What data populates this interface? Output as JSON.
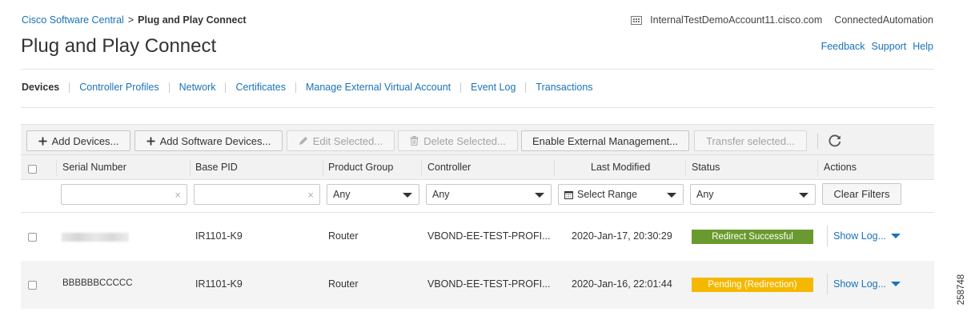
{
  "breadcrumb": {
    "root": "Cisco Software Central",
    "separator": ">",
    "current": "Plug and Play Connect"
  },
  "account": {
    "domain": "InternalTestDemoAccount11.cisco.com",
    "user": "ConnectedAutomation",
    "icon": "building-icon"
  },
  "page": {
    "title": "Plug and Play Connect"
  },
  "help_links": {
    "feedback": "Feedback",
    "support": "Support",
    "help": "Help"
  },
  "tabs": [
    {
      "label": "Devices",
      "active": true
    },
    {
      "label": "Controller Profiles"
    },
    {
      "label": "Network"
    },
    {
      "label": "Certificates"
    },
    {
      "label": "Manage External Virtual Account"
    },
    {
      "label": "Event Log"
    },
    {
      "label": "Transactions"
    }
  ],
  "toolbar": {
    "add_devices": "Add Devices...",
    "add_software_devices": "Add Software Devices...",
    "edit_selected": "Edit Selected...",
    "delete_selected": "Delete Selected...",
    "enable_external": "Enable External Management...",
    "transfer_selected": "Transfer selected..."
  },
  "columns": {
    "serial": "Serial Number",
    "base_pid": "Base PID",
    "product_group": "Product Group",
    "controller": "Controller",
    "last_modified": "Last Modified",
    "status": "Status",
    "actions": "Actions"
  },
  "filters": {
    "product_group": "Any",
    "controller": "Any",
    "last_modified": "Select Range",
    "status": "Any",
    "clear": "Clear Filters",
    "clear_glyph": "×"
  },
  "rows": [
    {
      "serial": "",
      "base_pid": "IR1101-K9",
      "product_group": "Router",
      "controller": "VBOND-EE-TEST-PROFI...",
      "last_modified": "2020-Jan-17, 20:30:29",
      "status": "Redirect Successful",
      "status_color": "#6a9a2f",
      "action": "Show Log..."
    },
    {
      "serial": "BBBBBBCCCCC",
      "base_pid": "IR1101-K9",
      "product_group": "Router",
      "controller": "VBOND-EE-TEST-PROFI...",
      "last_modified": "2020-Jan-16, 22:01:44",
      "status": "Pending (Redirection)",
      "status_color": "#f5b800",
      "action": "Show Log..."
    }
  ],
  "figure_number": "258748",
  "colors": {
    "link": "#1a73b8",
    "success": "#6a9a2f",
    "pending": "#f5b800"
  }
}
